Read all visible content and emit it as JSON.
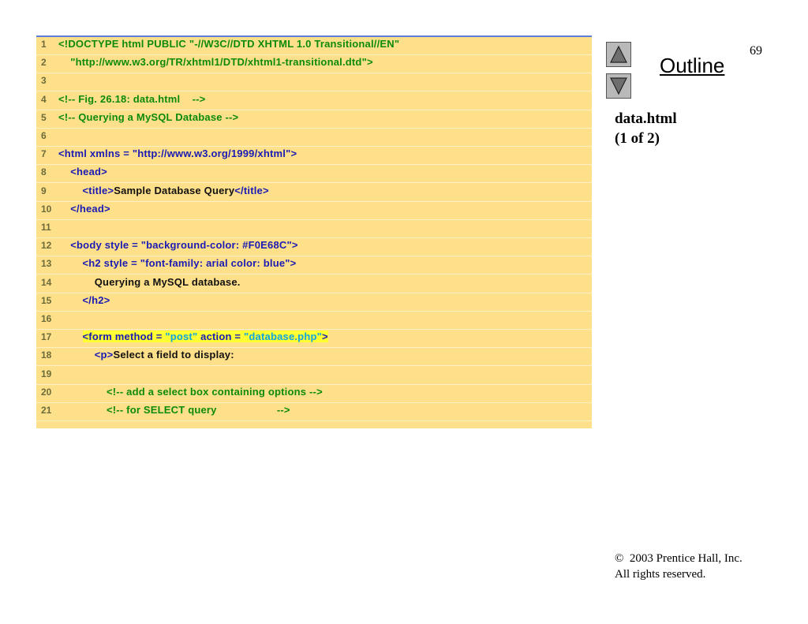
{
  "page_number": "69",
  "outline": {
    "label": "Outline",
    "up_icon": "triangle-up-icon",
    "down_icon": "triangle-down-icon"
  },
  "file_label": {
    "name": "data.html",
    "part": "(1 of 2)"
  },
  "copyright": {
    "symbol": "©",
    "line1": "2003 Prentice Hall, Inc.",
    "line2": "All rights reserved."
  },
  "colors": {
    "code_background": "#ffe08a",
    "comment": "#0c8a0c",
    "markup": "#1a1ab4",
    "highlight": "#ffff33",
    "highlight_string": "#0fa4e0"
  },
  "code_lines": [
    {
      "num": "1",
      "segments": [
        {
          "text": "<!DOCTYPE html PUBLIC \"-//W3C//DTD XHTML 1.0 Transitional//EN\"",
          "kind": "comment"
        }
      ]
    },
    {
      "num": "2",
      "segments": [
        {
          "text": "    \"http://www.w3.org/TR/xhtml1/DTD/xhtml1-transitional.dtd\">",
          "kind": "comment"
        }
      ]
    },
    {
      "num": "3",
      "segments": []
    },
    {
      "num": "4",
      "segments": [
        {
          "text": "<!-- Fig. 26.18: data.html    -->",
          "kind": "comment"
        }
      ]
    },
    {
      "num": "5",
      "segments": [
        {
          "text": "<!-- Querying a MySQL Database -->",
          "kind": "comment"
        }
      ]
    },
    {
      "num": "6",
      "segments": []
    },
    {
      "num": "7",
      "segments": [
        {
          "text": "<html xmlns = ",
          "kind": "tag"
        },
        {
          "text": "\"http://www.w3.org/1999/xhtml\"",
          "kind": "str"
        },
        {
          "text": ">",
          "kind": "tag"
        }
      ]
    },
    {
      "num": "8",
      "segments": [
        {
          "text": "    <head>",
          "kind": "tag"
        }
      ]
    },
    {
      "num": "9",
      "segments": [
        {
          "text": "        <title>",
          "kind": "tag"
        },
        {
          "text": "Sample Database Query",
          "kind": "text"
        },
        {
          "text": "</title>",
          "kind": "tag"
        }
      ]
    },
    {
      "num": "10",
      "segments": [
        {
          "text": "    </head>",
          "kind": "tag"
        }
      ]
    },
    {
      "num": "11",
      "segments": []
    },
    {
      "num": "12",
      "segments": [
        {
          "text": "    <body style = ",
          "kind": "tag"
        },
        {
          "text": "\"background-color: #F0E68C\"",
          "kind": "str"
        },
        {
          "text": ">",
          "kind": "tag"
        }
      ]
    },
    {
      "num": "13",
      "segments": [
        {
          "text": "        <h2 style = ",
          "kind": "tag"
        },
        {
          "text": "\"font-family: arial color: blue\"",
          "kind": "str"
        },
        {
          "text": ">",
          "kind": "tag"
        }
      ]
    },
    {
      "num": "14",
      "segments": [
        {
          "text": "            Querying a MySQL database.",
          "kind": "text"
        }
      ]
    },
    {
      "num": "15",
      "segments": [
        {
          "text": "        </h2>",
          "kind": "tag"
        }
      ]
    },
    {
      "num": "16",
      "segments": []
    },
    {
      "num": "17",
      "segments": [
        {
          "text": "        ",
          "kind": "text"
        },
        {
          "text": "<form method = ",
          "kind": "tag-hl"
        },
        {
          "text": "\"post\"",
          "kind": "str-hl"
        },
        {
          "text": " action = ",
          "kind": "tag-hl"
        },
        {
          "text": "\"database.php\"",
          "kind": "str-hl"
        },
        {
          "text": ">",
          "kind": "tag-hl"
        }
      ]
    },
    {
      "num": "18",
      "segments": [
        {
          "text": "            <p>",
          "kind": "tag"
        },
        {
          "text": "Select a field to display:",
          "kind": "text"
        }
      ]
    },
    {
      "num": "19",
      "segments": []
    },
    {
      "num": "20",
      "segments": [
        {
          "text": "                <!-- add a select box containing options -->",
          "kind": "comment"
        }
      ]
    },
    {
      "num": "21",
      "segments": [
        {
          "text": "                <!-- for SELECT query                    -->",
          "kind": "comment"
        }
      ]
    }
  ]
}
